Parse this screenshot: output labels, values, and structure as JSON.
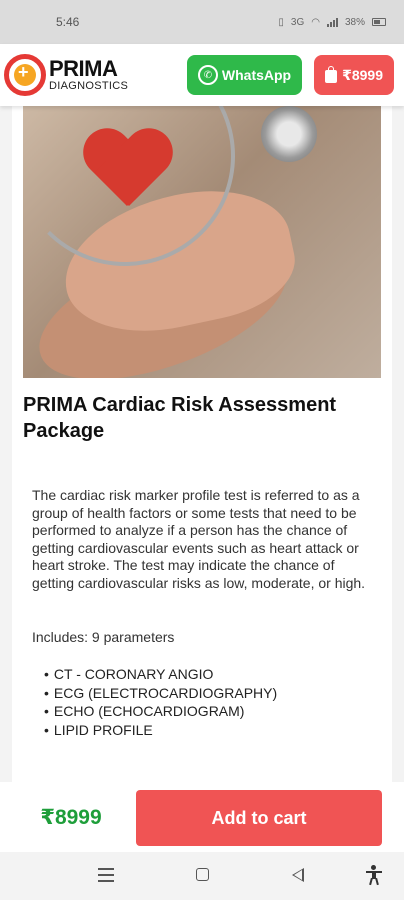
{
  "status_bar": {
    "time": "5:46",
    "network": "3G",
    "battery": "38%"
  },
  "header": {
    "brand_name": "PRIMA",
    "brand_sub": "DIAGNOSTICS",
    "whatsapp_label": "WhatsApp",
    "price_button_label": "₹8999"
  },
  "product": {
    "title": "PRIMA Cardiac Risk Assessment Package",
    "description": "The cardiac risk marker profile test is referred to as a group of health factors or some tests that need to be performed to analyze if a person has the chance of getting cardiovascular events such as heart attack or heart stroke. The test may indicate the chance of getting cardiovascular risks as low, moderate, or high.",
    "includes_label": "Includes: 9 parameters",
    "parameters": [
      "CT - CORONARY ANGIO",
      "ECG (ELECTROCARDIOGRAPHY)",
      "ECHO (ECHOCARDIOGRAM)",
      "LIPID PROFILE"
    ]
  },
  "bottom_bar": {
    "price": "₹8999",
    "add_to_cart_label": "Add to cart"
  },
  "colors": {
    "whatsapp_green": "#2fb94a",
    "accent_red": "#f05454",
    "price_green": "#1e9e3a"
  },
  "icons": {
    "whatsapp": "whatsapp-icon",
    "cart": "shopping-bag-icon",
    "nav_menu": "recent-apps-icon",
    "nav_home": "home-icon",
    "nav_back": "back-icon",
    "accessibility": "accessibility-icon"
  }
}
